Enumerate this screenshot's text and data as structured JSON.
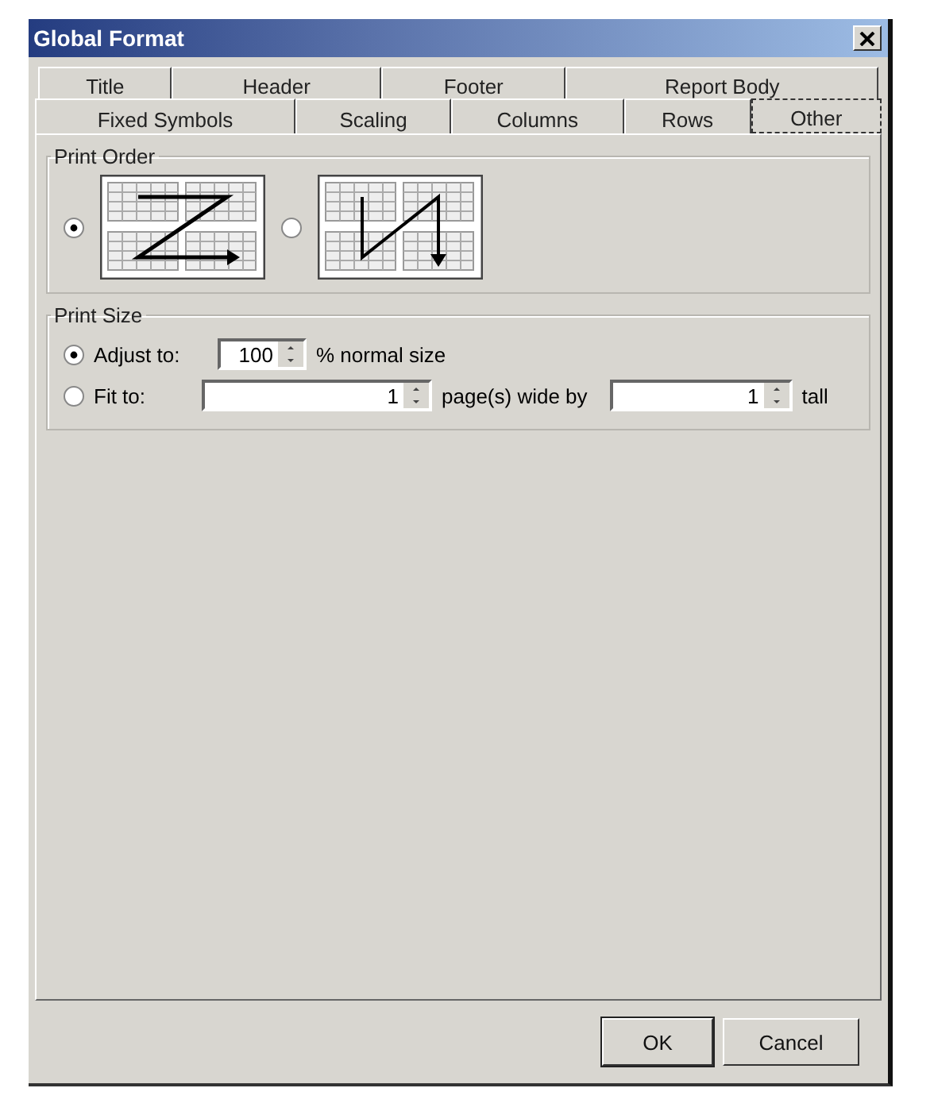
{
  "window": {
    "title": "Global Format"
  },
  "tab_rows": [
    {
      "tabs": [
        {
          "label": "Title",
          "selected": false
        },
        {
          "label": "Header",
          "selected": false
        },
        {
          "label": "Footer",
          "selected": false
        },
        {
          "label": "Report Body",
          "selected": false
        }
      ]
    },
    {
      "tabs": [
        {
          "label": "Fixed Symbols",
          "selected": false
        },
        {
          "label": "Scaling",
          "selected": false
        },
        {
          "label": "Columns",
          "selected": false
        },
        {
          "label": "Rows",
          "selected": false
        },
        {
          "label": "Other",
          "selected": true
        }
      ]
    }
  ],
  "print_order": {
    "title": "Print Order",
    "options": [
      {
        "kind": "across",
        "selected": true
      },
      {
        "kind": "down",
        "selected": false
      }
    ]
  },
  "print_size": {
    "title": "Print Size",
    "options": [
      {
        "label": "Adjust to:",
        "selected": true,
        "fields": [
          {
            "value": "100",
            "suffix": "% normal size"
          }
        ]
      },
      {
        "label": "Fit to:",
        "selected": false,
        "fields": [
          {
            "value": "1",
            "suffix": "page(s) wide by"
          },
          {
            "value": "1",
            "suffix": "tall"
          }
        ]
      }
    ]
  },
  "buttons": [
    {
      "label": "OK",
      "default": true
    },
    {
      "label": "Cancel",
      "default": false
    }
  ]
}
